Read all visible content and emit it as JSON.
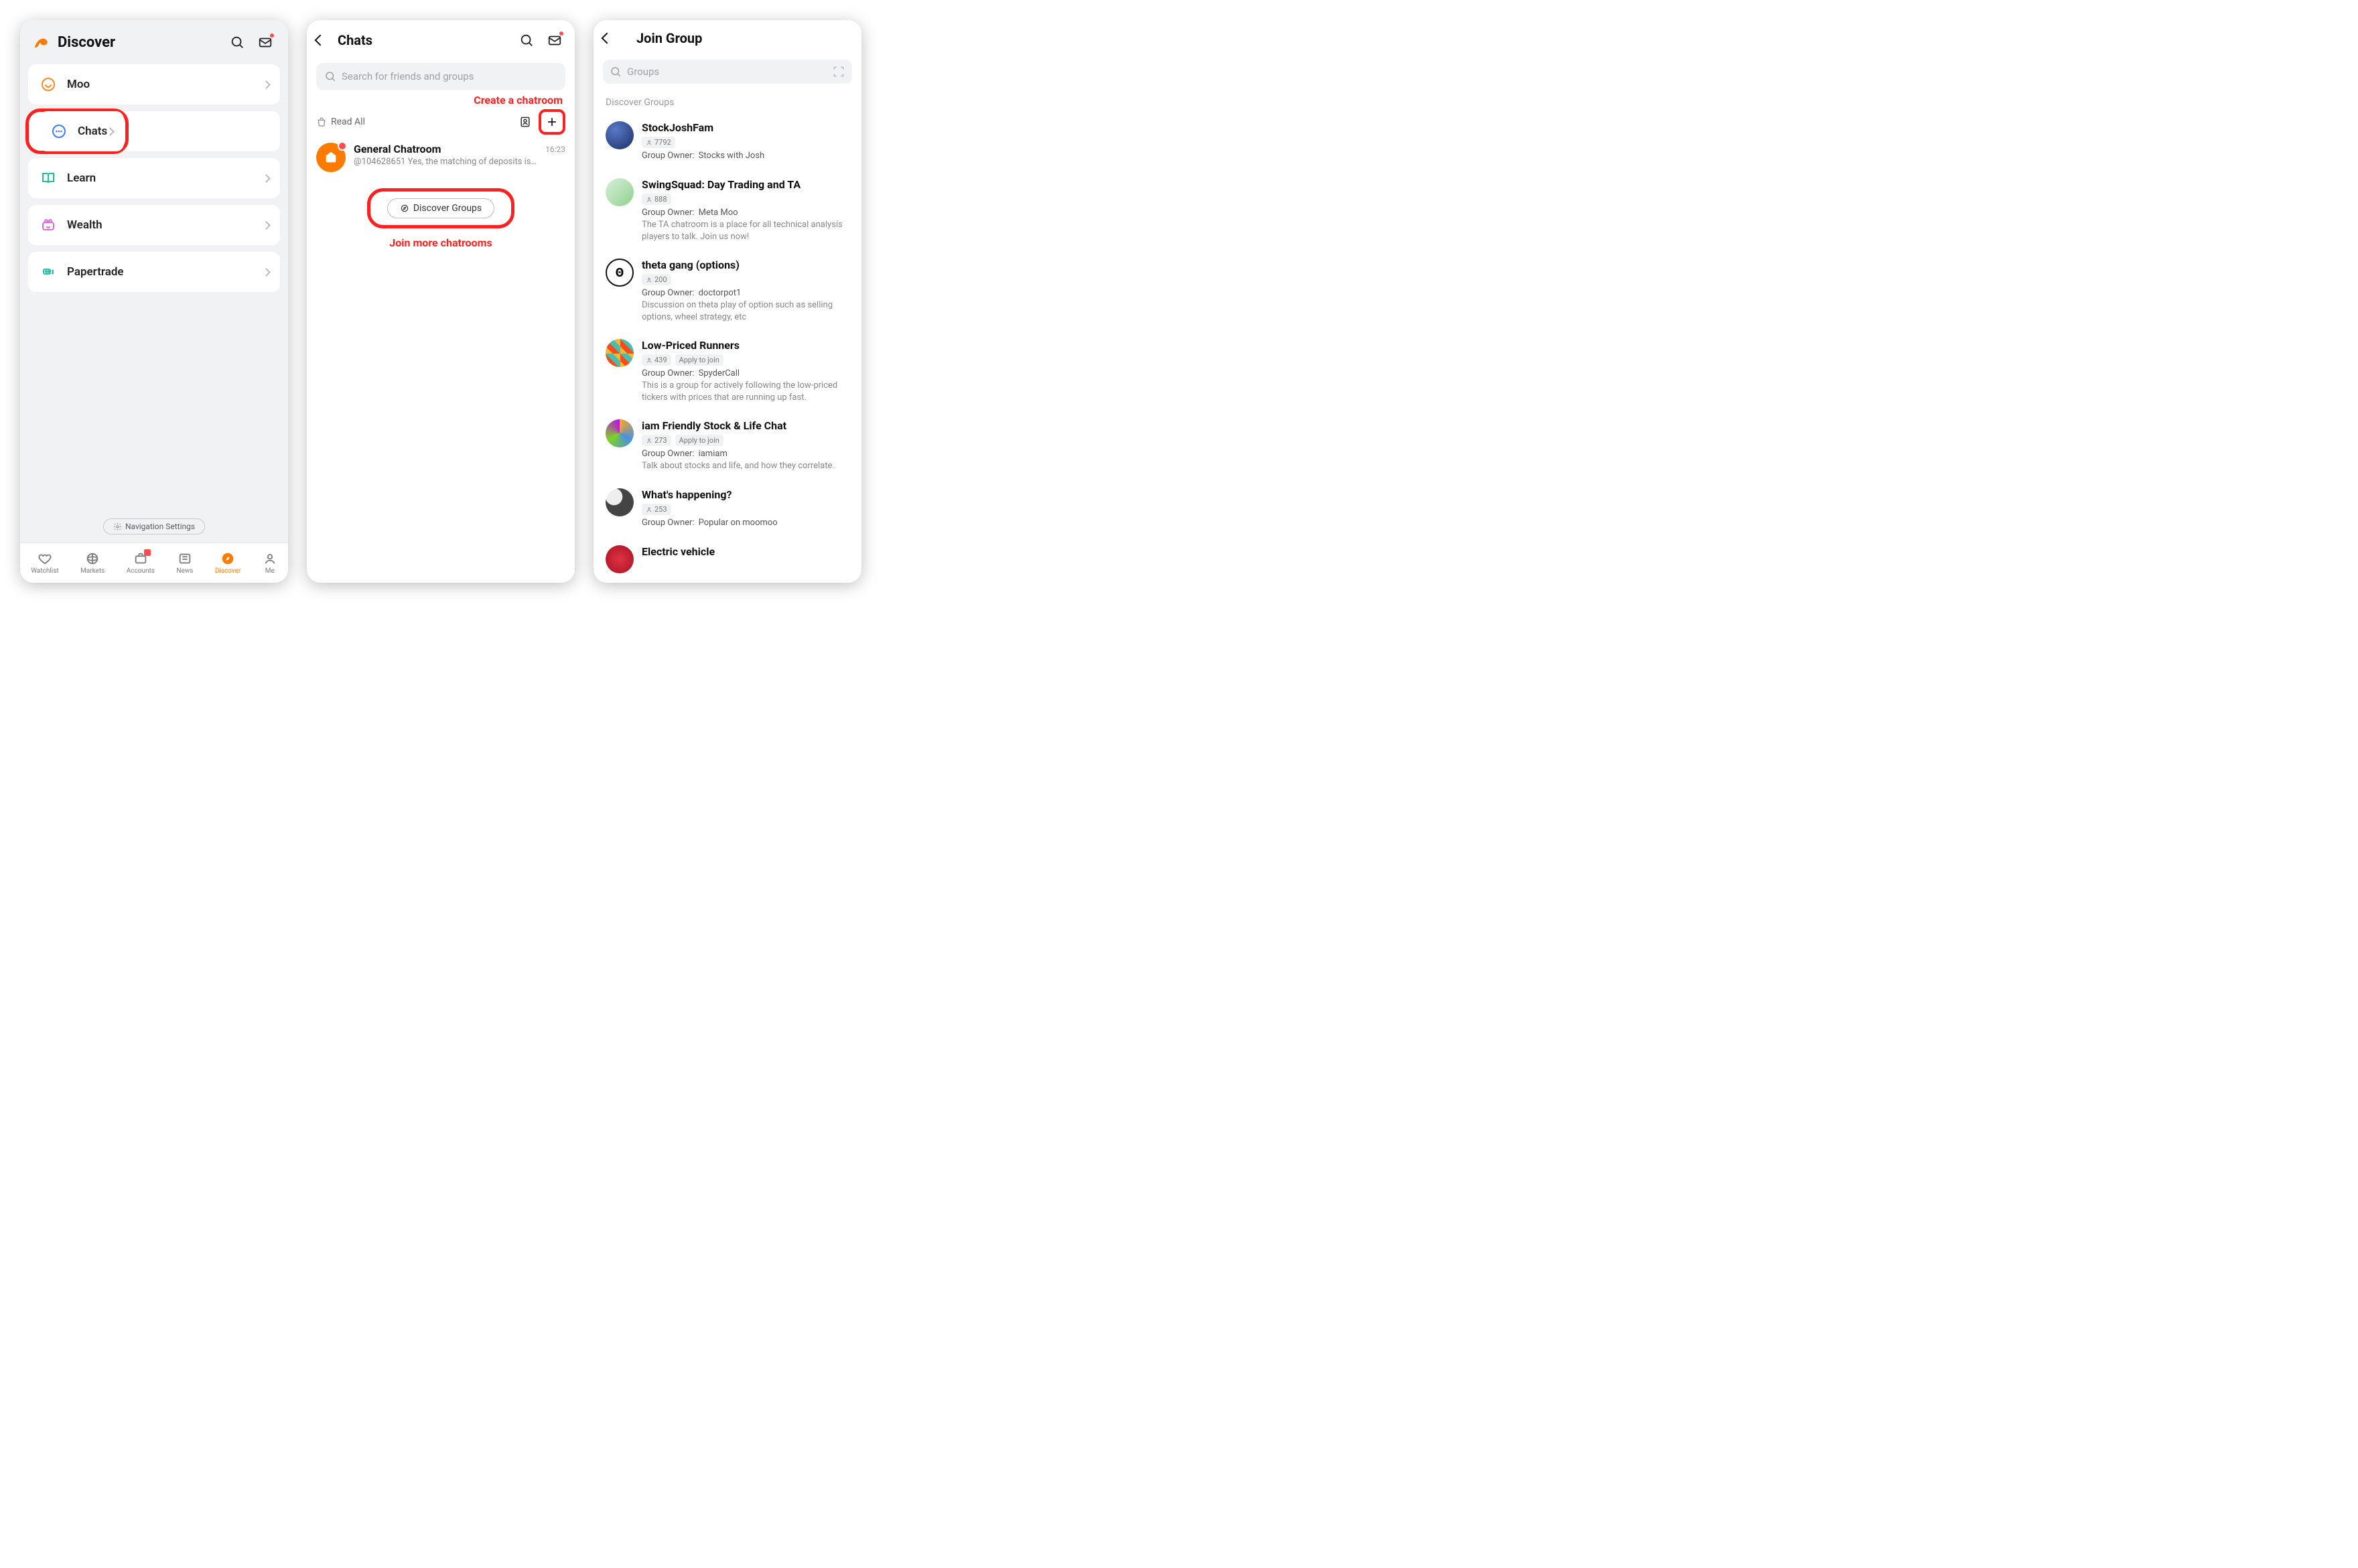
{
  "screen1": {
    "title": "Discover",
    "menu": [
      {
        "label": "Moo"
      },
      {
        "label": "Chats"
      },
      {
        "label": "Learn"
      },
      {
        "label": "Wealth"
      },
      {
        "label": "Papertrade"
      }
    ],
    "nav_settings": "Navigation Settings",
    "tabs": [
      {
        "label": "Watchlist"
      },
      {
        "label": "Markets"
      },
      {
        "label": "Accounts"
      },
      {
        "label": "News"
      },
      {
        "label": "Discover"
      },
      {
        "label": "Me"
      }
    ]
  },
  "screen2": {
    "title": "Chats",
    "search_placeholder": "Search for friends and groups",
    "annotation_create": "Create a chatroom",
    "read_all": "Read All",
    "chat": {
      "name": "General Chatroom",
      "time": "16:23",
      "preview": "@104628651 Yes, the matching of deposits is…"
    },
    "discover_btn": "Discover Groups",
    "annotation_join": "Join more chatrooms"
  },
  "screen3": {
    "title": "Join Group",
    "search_placeholder": "Groups",
    "section": "Discover Groups",
    "owner_label": "Group Owner:",
    "groups": [
      {
        "name": "StockJoshFam",
        "count": "7792",
        "owner": "Stocks with Josh",
        "desc": "",
        "apply": false
      },
      {
        "name": "SwingSquad: Day Trading and TA",
        "count": "888",
        "owner": "Meta Moo",
        "desc": "The TA chatroom is a place for all technical analysis players to talk. Join us now!",
        "apply": false
      },
      {
        "name": "theta gang (options)",
        "count": "200",
        "owner": "doctorpot1",
        "desc": "Discussion on theta play of option such as selling options, wheel strategy, etc",
        "apply": false
      },
      {
        "name": "Low-Priced Runners",
        "count": "439",
        "owner": "SpyderCall",
        "desc": "This is a group for actively following the low-priced tickers with prices that are running up fast.",
        "apply": true
      },
      {
        "name": "iam Friendly Stock & Life Chat",
        "count": "273",
        "owner": "iamiam",
        "desc": "Talk about stocks and life, and how they correlate.",
        "apply": true
      },
      {
        "name": "What's happening?",
        "count": "253",
        "owner": "Popular on moomoo",
        "desc": "",
        "apply": false
      },
      {
        "name": "Electric vehicle",
        "count": "",
        "owner": "",
        "desc": "",
        "apply": false
      }
    ],
    "apply_label": "Apply to join"
  }
}
